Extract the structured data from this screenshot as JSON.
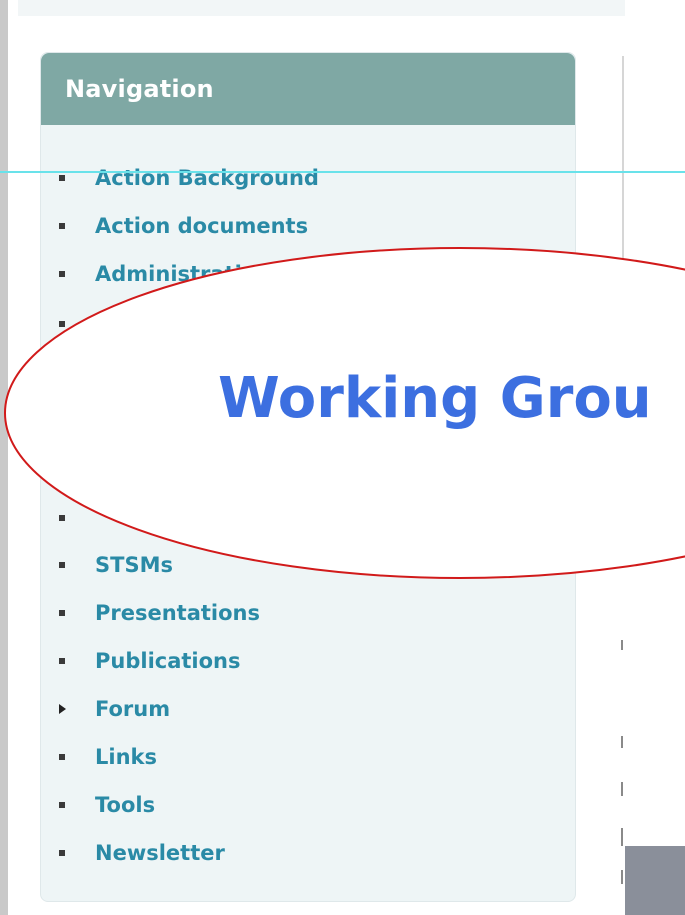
{
  "navigation": {
    "title": "Navigation",
    "items": [
      {
        "label": "Action Background",
        "bullet": "square"
      },
      {
        "label": "Action documents",
        "bullet": "square"
      },
      {
        "label": "Administrative",
        "bullet": "square"
      },
      {
        "label": "",
        "bullet": "square"
      },
      {
        "label": "",
        "bullet": "square"
      },
      {
        "label": "STSMs",
        "bullet": "square"
      },
      {
        "label": "Presentations",
        "bullet": "square"
      },
      {
        "label": "Publications",
        "bullet": "square"
      },
      {
        "label": "Forum",
        "bullet": "triangle"
      },
      {
        "label": "Links",
        "bullet": "square"
      },
      {
        "label": "Tools",
        "bullet": "square"
      },
      {
        "label": "Newsletter",
        "bullet": "square"
      }
    ]
  },
  "callout": {
    "text": "Working Grou",
    "text_color": "#3c6fe0",
    "border_color": "#d11a1a"
  },
  "colors": {
    "header_bg": "#7fa8a4",
    "link": "#2a8aa6",
    "panel_bg": "#eef5f6",
    "guide_line": "#69e2ea"
  }
}
